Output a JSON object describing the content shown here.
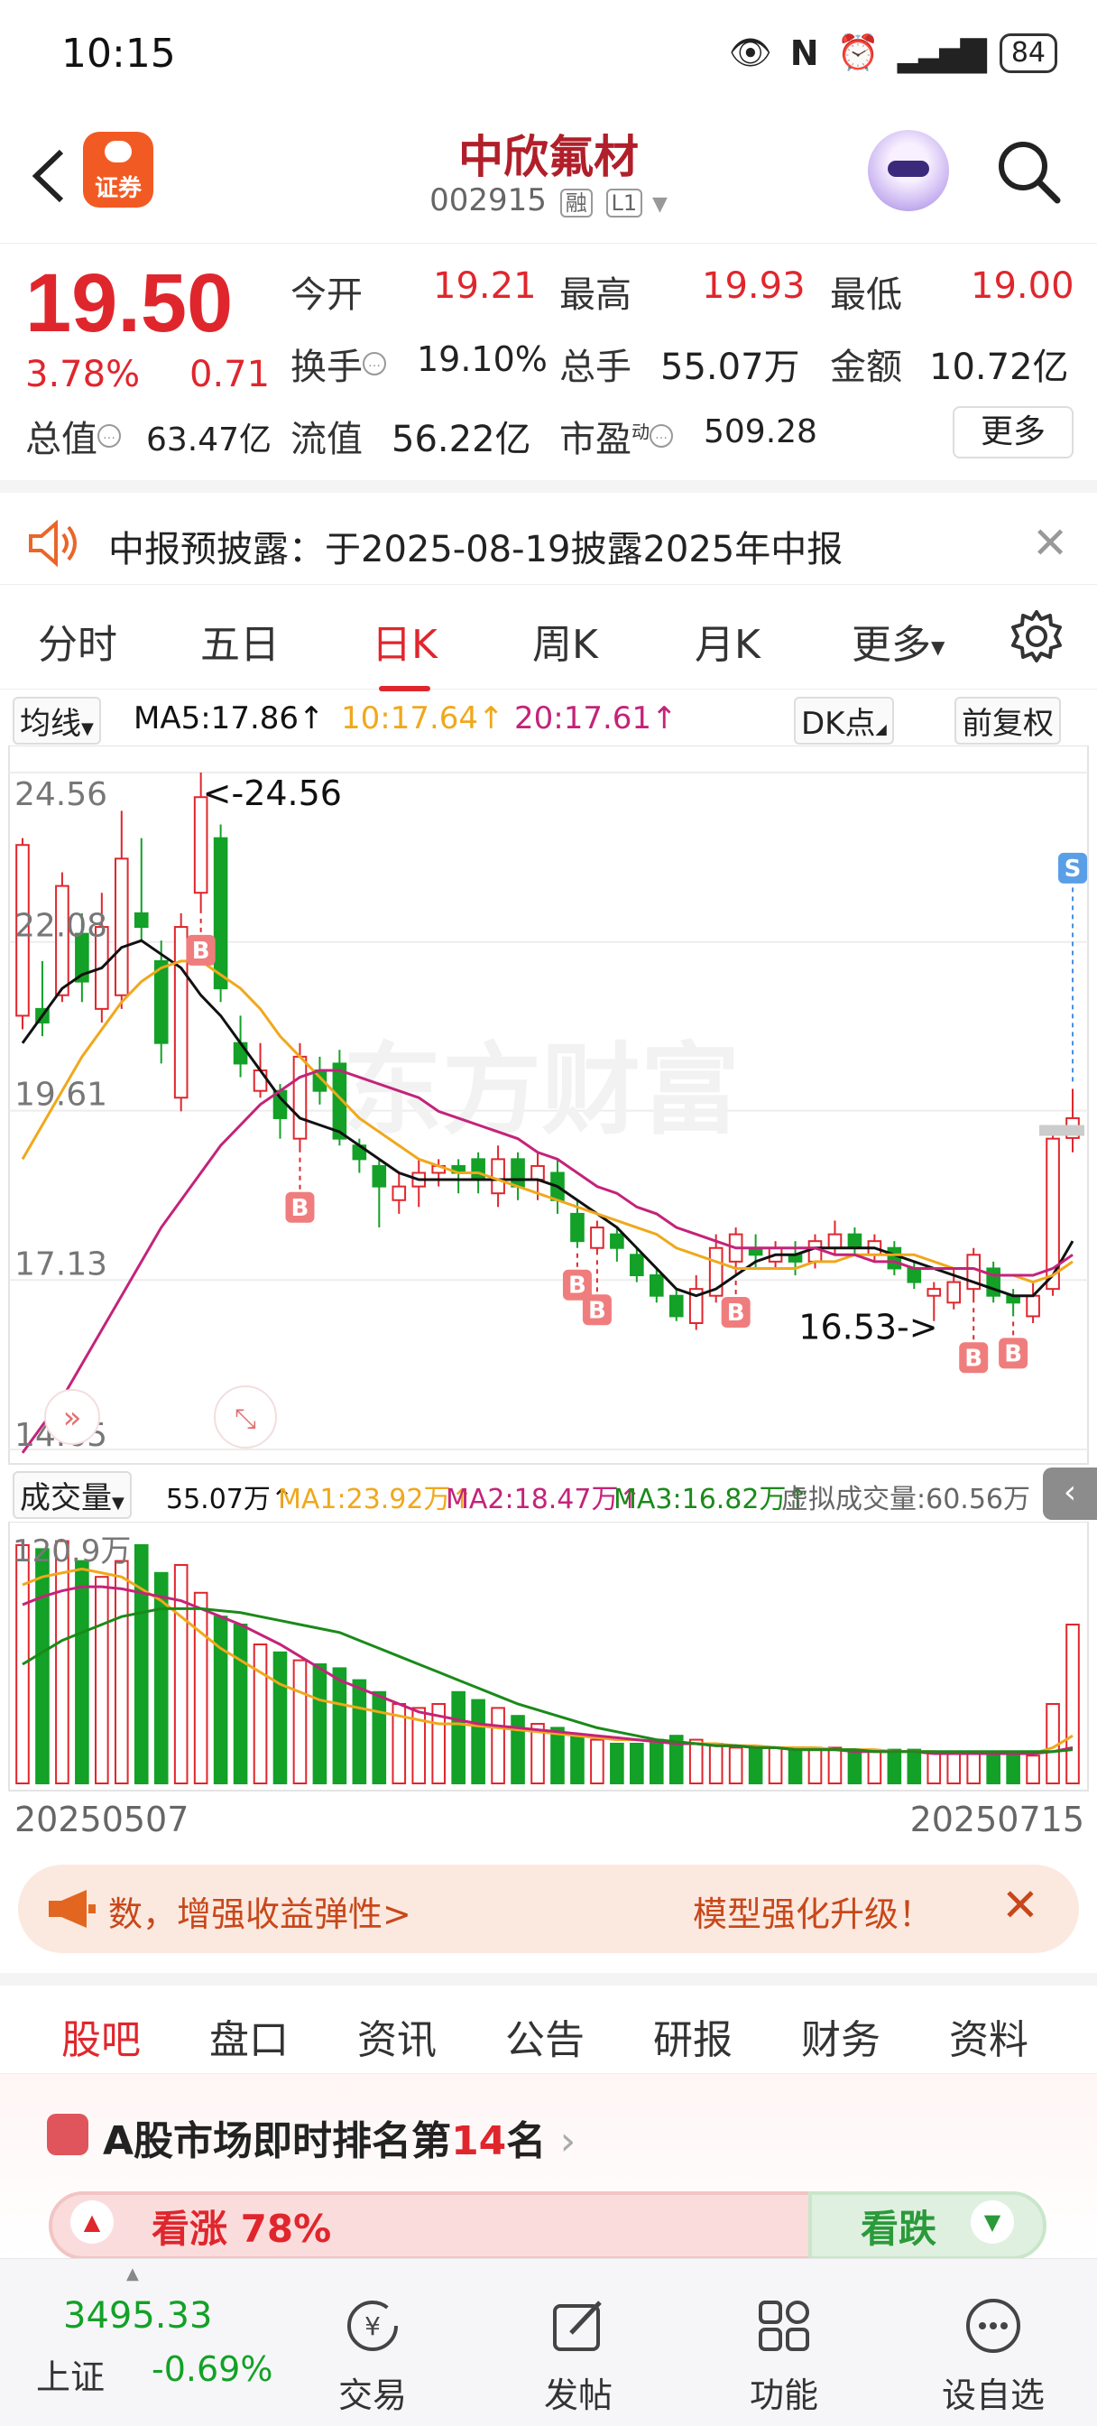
{
  "status_bar": {
    "time": "10:15",
    "battery": "84"
  },
  "header": {
    "logo_text": "证券",
    "stock_name": "中欣氟材",
    "stock_code": "002915",
    "tag_margin": "融",
    "tag_level": "L1"
  },
  "quote": {
    "price": "19.50",
    "change_pct": "3.78%",
    "change": "0.71",
    "open_label": "今开",
    "open": "19.21",
    "high_label": "最高",
    "high": "19.93",
    "low_label": "最低",
    "low": "19.00",
    "turnover_label": "换手",
    "turnover": "19.10%",
    "volume_label": "总手",
    "volume": "55.07万",
    "amount_label": "金额",
    "amount": "10.72亿",
    "mcap_label": "总值",
    "mcap": "63.47亿",
    "float_label": "流值",
    "float": "56.22亿",
    "pe_label": "市盈",
    "pe_sup": "动",
    "pe": "509.28",
    "more_button": "更多"
  },
  "notice": {
    "text": "中报预披露：于2025-08-19披露2025年中报"
  },
  "period_tabs": [
    "分时",
    "五日",
    "日K",
    "周K",
    "月K",
    "更多"
  ],
  "active_period": "日K",
  "ma_row": {
    "ma_select": "均线",
    "ma5": "MA5:17.86",
    "ma10": "10:17.64",
    "ma20": "20:17.61",
    "dk_button": "DK点",
    "adjust_button": "前复权"
  },
  "volume_row": {
    "select": "成交量",
    "vol": "55.07万",
    "ma1": "MA1:23.92万",
    "ma2": "MA2:18.47万",
    "ma3": "MA3:16.82万",
    "virtual": "虚拟成交量:60.56万"
  },
  "chart_data": {
    "type": "candlestick",
    "y_ticks": [
      "24.56",
      "22.08",
      "19.61",
      "17.13",
      "14.65"
    ],
    "ylim": [
      14.65,
      24.56
    ],
    "annotations": {
      "high_label": "<-24.56",
      "low_label": "16.53->",
      "buy_marker": "B",
      "sell_marker": "S"
    },
    "start_date": "20250507",
    "end_date": "20250715",
    "watermark": "东方财富",
    "candles": [
      {
        "o": 21.0,
        "c": 23.5,
        "h": 23.6,
        "l": 20.8
      },
      {
        "o": 21.1,
        "c": 20.9,
        "h": 21.8,
        "l": 20.7
      },
      {
        "o": 21.3,
        "c": 22.9,
        "h": 23.1,
        "l": 21.2
      },
      {
        "o": 22.2,
        "c": 21.5,
        "h": 22.5,
        "l": 21.2
      },
      {
        "o": 21.1,
        "c": 22.3,
        "h": 22.8,
        "l": 20.9
      },
      {
        "o": 21.3,
        "c": 23.3,
        "h": 24.0,
        "l": 21.1
      },
      {
        "o": 22.5,
        "c": 22.3,
        "h": 23.6,
        "l": 22.1
      },
      {
        "o": 21.8,
        "c": 20.6,
        "h": 22.1,
        "l": 20.3
      },
      {
        "o": 19.8,
        "c": 22.3,
        "h": 22.5,
        "l": 19.6
      },
      {
        "o": 22.8,
        "c": 24.2,
        "h": 24.56,
        "l": 22.5
      },
      {
        "o": 23.6,
        "c": 21.4,
        "h": 23.8,
        "l": 21.2
      },
      {
        "o": 20.6,
        "c": 20.3,
        "h": 21.0,
        "l": 20.1
      },
      {
        "o": 19.9,
        "c": 20.2,
        "h": 20.6,
        "l": 19.8
      },
      {
        "o": 19.9,
        "c": 19.5,
        "h": 20.0,
        "l": 19.2
      },
      {
        "o": 19.2,
        "c": 20.4,
        "h": 20.6,
        "l": 19.0
      },
      {
        "o": 20.2,
        "c": 19.9,
        "h": 20.4,
        "l": 19.7
      },
      {
        "o": 20.3,
        "c": 19.2,
        "h": 20.5,
        "l": 19.1
      },
      {
        "o": 19.1,
        "c": 18.9,
        "h": 19.2,
        "l": 18.7
      },
      {
        "o": 18.8,
        "c": 18.5,
        "h": 18.9,
        "l": 17.9
      },
      {
        "o": 18.3,
        "c": 18.5,
        "h": 18.7,
        "l": 18.1
      },
      {
        "o": 18.5,
        "c": 18.7,
        "h": 18.9,
        "l": 18.2
      },
      {
        "o": 18.7,
        "c": 18.8,
        "h": 18.9,
        "l": 18.5
      },
      {
        "o": 18.8,
        "c": 18.7,
        "h": 18.9,
        "l": 18.4
      },
      {
        "o": 18.9,
        "c": 18.6,
        "h": 19.0,
        "l": 18.4
      },
      {
        "o": 18.4,
        "c": 18.9,
        "h": 19.1,
        "l": 18.2
      },
      {
        "o": 18.9,
        "c": 18.5,
        "h": 19.0,
        "l": 18.3
      },
      {
        "o": 18.6,
        "c": 18.8,
        "h": 19.0,
        "l": 18.3
      },
      {
        "o": 18.7,
        "c": 18.3,
        "h": 18.9,
        "l": 18.1
      },
      {
        "o": 18.1,
        "c": 17.7,
        "h": 18.3,
        "l": 17.6
      },
      {
        "o": 17.6,
        "c": 17.9,
        "h": 18.0,
        "l": 17.5
      },
      {
        "o": 17.8,
        "c": 17.6,
        "h": 17.9,
        "l": 17.4
      },
      {
        "o": 17.5,
        "c": 17.2,
        "h": 17.6,
        "l": 17.1
      },
      {
        "o": 17.2,
        "c": 16.9,
        "h": 17.3,
        "l": 16.8
      },
      {
        "o": 16.9,
        "c": 16.6,
        "h": 17.0,
        "l": 16.53
      },
      {
        "o": 16.5,
        "c": 17.0,
        "h": 17.2,
        "l": 16.4
      },
      {
        "o": 16.9,
        "c": 17.6,
        "h": 17.8,
        "l": 16.8
      },
      {
        "o": 17.4,
        "c": 17.8,
        "h": 17.9,
        "l": 17.2
      },
      {
        "o": 17.6,
        "c": 17.5,
        "h": 17.8,
        "l": 17.3
      },
      {
        "o": 17.4,
        "c": 17.6,
        "h": 17.7,
        "l": 17.3
      },
      {
        "o": 17.5,
        "c": 17.4,
        "h": 17.7,
        "l": 17.2
      },
      {
        "o": 17.4,
        "c": 17.7,
        "h": 17.8,
        "l": 17.3
      },
      {
        "o": 17.6,
        "c": 17.8,
        "h": 18.0,
        "l": 17.5
      },
      {
        "o": 17.8,
        "c": 17.6,
        "h": 17.9,
        "l": 17.5
      },
      {
        "o": 17.5,
        "c": 17.7,
        "h": 17.8,
        "l": 17.4
      },
      {
        "o": 17.6,
        "c": 17.3,
        "h": 17.7,
        "l": 17.2
      },
      {
        "o": 17.3,
        "c": 17.1,
        "h": 17.4,
        "l": 17.0
      },
      {
        "o": 16.9,
        "c": 17.0,
        "h": 17.1,
        "l": 16.53
      },
      {
        "o": 16.8,
        "c": 17.1,
        "h": 17.3,
        "l": 16.7
      },
      {
        "o": 17.0,
        "c": 17.5,
        "h": 17.6,
        "l": 16.8
      },
      {
        "o": 17.3,
        "c": 16.9,
        "h": 17.4,
        "l": 16.8
      },
      {
        "o": 16.9,
        "c": 16.8,
        "h": 17.0,
        "l": 16.6
      },
      {
        "o": 16.6,
        "c": 16.9,
        "h": 17.1,
        "l": 16.5
      },
      {
        "o": 17.0,
        "c": 19.2,
        "h": 19.3,
        "l": 16.9
      },
      {
        "o": 19.21,
        "c": 19.5,
        "h": 19.93,
        "l": 19.0
      }
    ],
    "ma5": [
      20.6,
      21.0,
      21.4,
      21.6,
      21.7,
      22.0,
      22.1,
      21.9,
      21.7,
      21.3,
      21.0,
      20.6,
      20.2,
      19.8,
      19.5,
      19.4,
      19.3,
      19.1,
      18.9,
      18.7,
      18.6,
      18.6,
      18.6,
      18.6,
      18.6,
      18.6,
      18.6,
      18.5,
      18.3,
      18.1,
      17.9,
      17.6,
      17.3,
      17.0,
      16.9,
      17.0,
      17.2,
      17.4,
      17.5,
      17.5,
      17.6,
      17.6,
      17.6,
      17.6,
      17.5,
      17.4,
      17.3,
      17.2,
      17.1,
      17.0,
      16.9,
      16.9,
      17.2,
      17.7
    ],
    "ma10": [
      18.9,
      19.4,
      19.9,
      20.4,
      20.8,
      21.2,
      21.5,
      21.7,
      21.8,
      21.8,
      21.6,
      21.4,
      21.1,
      20.7,
      20.4,
      20.1,
      19.8,
      19.5,
      19.3,
      19.1,
      18.9,
      18.8,
      18.7,
      18.7,
      18.6,
      18.5,
      18.4,
      18.3,
      18.2,
      18.1,
      18.0,
      17.9,
      17.8,
      17.6,
      17.5,
      17.4,
      17.3,
      17.3,
      17.3,
      17.3,
      17.4,
      17.4,
      17.5,
      17.5,
      17.5,
      17.5,
      17.4,
      17.3,
      17.3,
      17.2,
      17.2,
      17.1,
      17.2,
      17.4
    ],
    "ma20": [
      14.6,
      15.0,
      15.4,
      15.9,
      16.4,
      16.9,
      17.4,
      17.9,
      18.3,
      18.7,
      19.1,
      19.4,
      19.7,
      19.9,
      20.1,
      20.2,
      20.2,
      20.1,
      20.0,
      19.9,
      19.8,
      19.6,
      19.5,
      19.4,
      19.3,
      19.2,
      19.0,
      18.9,
      18.7,
      18.5,
      18.4,
      18.2,
      18.1,
      17.9,
      17.8,
      17.7,
      17.6,
      17.6,
      17.6,
      17.6,
      17.6,
      17.5,
      17.5,
      17.4,
      17.4,
      17.3,
      17.3,
      17.3,
      17.3,
      17.2,
      17.2,
      17.2,
      17.3,
      17.5
    ],
    "volume_tick": "120.9万",
    "volumes": [
      120,
      118,
      122,
      112,
      104,
      112,
      120,
      106,
      110,
      96,
      84,
      80,
      70,
      66,
      62,
      60,
      58,
      52,
      46,
      40,
      38,
      40,
      46,
      42,
      38,
      34,
      30,
      28,
      24,
      22,
      20,
      20,
      22,
      24,
      22,
      20,
      18,
      18,
      18,
      17,
      18,
      18,
      17,
      16,
      17,
      17,
      16,
      16,
      15,
      15,
      14,
      14,
      40,
      80
    ],
    "vol_ma1": [
      100,
      104,
      106,
      108,
      106,
      104,
      98,
      92,
      84,
      76,
      68,
      62,
      56,
      50,
      46,
      42,
      40,
      38,
      36,
      34,
      32,
      30,
      30,
      29,
      28,
      27,
      26,
      25,
      24,
      23,
      22,
      22,
      21,
      21,
      20,
      20,
      19,
      19,
      18,
      18,
      18,
      17,
      17,
      17,
      16,
      16,
      16,
      15,
      15,
      15,
      15,
      15,
      18,
      24
    ],
    "vol_ma2": [
      90,
      94,
      97,
      99,
      99,
      98,
      96,
      94,
      92,
      88,
      84,
      80,
      75,
      70,
      64,
      58,
      52,
      48,
      44,
      40,
      36,
      34,
      32,
      30,
      29,
      28,
      27,
      26,
      25,
      24,
      23,
      22,
      21,
      20,
      20,
      19,
      19,
      18,
      18,
      17,
      17,
      17,
      16,
      16,
      16,
      16,
      15,
      15,
      15,
      15,
      15,
      15,
      16,
      18
    ],
    "vol_ma3": [
      60,
      66,
      72,
      76,
      80,
      84,
      86,
      88,
      88,
      88,
      87,
      86,
      84,
      82,
      80,
      78,
      76,
      72,
      68,
      64,
      60,
      56,
      52,
      48,
      44,
      40,
      37,
      34,
      31,
      28,
      26,
      24,
      22,
      21,
      20,
      19,
      19,
      18,
      18,
      17,
      17,
      17,
      17,
      16,
      16,
      16,
      16,
      16,
      16,
      16,
      16,
      16,
      16,
      17
    ]
  },
  "banner": {
    "left_text": "数，增强收益弹性>",
    "right_text": "模型强化升级！"
  },
  "bottom_tabs": [
    "股吧",
    "盘口",
    "资讯",
    "公告",
    "研报",
    "财务",
    "资料"
  ],
  "active_bottom_tab": "股吧",
  "rank": {
    "prefix": "A股市场即时排名第",
    "rank": "14",
    "suffix": "名",
    "up_label": "看涨 78%",
    "down_label": "看跌"
  },
  "nav": {
    "index_value": "3495.33",
    "index_name": "上证",
    "index_change": "-0.69%",
    "items": [
      "交易",
      "发帖",
      "功能",
      "设自选"
    ]
  },
  "colors": {
    "up": "#e0262d",
    "down": "#13a127",
    "ma5": "#111111",
    "ma10": "#f0a81c",
    "ma20": "#c4237a",
    "vma3": "#1a8a1a"
  }
}
